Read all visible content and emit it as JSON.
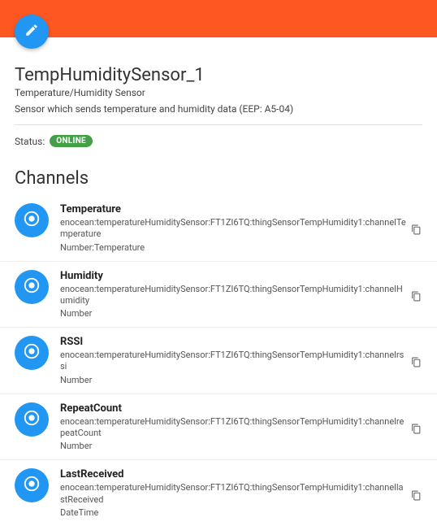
{
  "thing": {
    "title": "TempHumiditySensor_1",
    "subtitle": "Temperature/Humidity Sensor",
    "description": "Sensor which sends temperature and humidity data (EEP: A5-04)",
    "status_label": "Status:",
    "status_value": "ONLINE"
  },
  "sections": {
    "channels_heading": "Channels"
  },
  "channels": [
    {
      "name": "Temperature",
      "uid": "enocean:temperatureHumiditySensor:FT1ZI6TQ:thingSensorTempHumidity1:channelTemperature",
      "item_type": "Number:Temperature"
    },
    {
      "name": "Humidity",
      "uid": "enocean:temperatureHumiditySensor:FT1ZI6TQ:thingSensorTempHumidity1:channelHumidity",
      "item_type": "Number"
    },
    {
      "name": "RSSI",
      "uid": "enocean:temperatureHumiditySensor:FT1ZI6TQ:thingSensorTempHumidity1:channelrssi",
      "item_type": "Number"
    },
    {
      "name": "RepeatCount",
      "uid": "enocean:temperatureHumiditySensor:FT1ZI6TQ:thingSensorTempHumidity1:channelrepeatCount",
      "item_type": "Number"
    },
    {
      "name": "LastReceived",
      "uid": "enocean:temperatureHumiditySensor:FT1ZI6TQ:thingSensorTempHumidity1:channellastReceived",
      "item_type": "DateTime"
    }
  ],
  "icons": {
    "edit": "pencil-icon",
    "channel": "radio-button-icon",
    "copy": "copy-icon"
  }
}
